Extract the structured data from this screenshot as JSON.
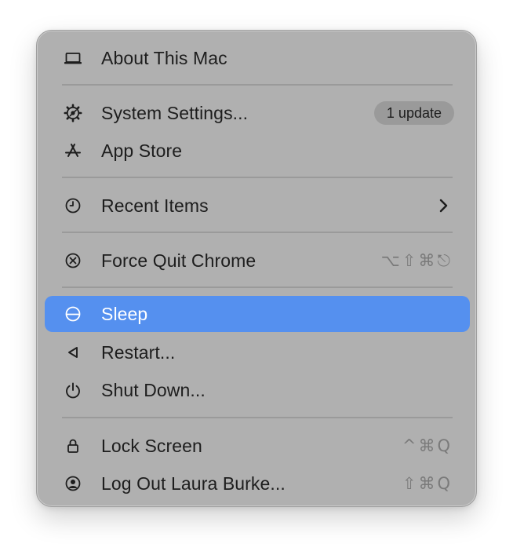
{
  "menu": {
    "about": {
      "label": "About This Mac",
      "icon": "laptop-icon"
    },
    "settings": {
      "label": "System Settings...",
      "icon": "gear-icon",
      "badge": "1 update"
    },
    "app_store": {
      "label": "App Store",
      "icon": "app-store-icon"
    },
    "recent_items": {
      "label": "Recent Items",
      "icon": "clock-icon",
      "submenu_icon": "chevron-right-icon"
    },
    "force_quit": {
      "label": "Force Quit Chrome",
      "icon": "force-quit-icon",
      "shortcut": "⌥⇧⌘⎋"
    },
    "sleep": {
      "label": "Sleep",
      "icon": "sleep-icon",
      "highlighted": true
    },
    "restart": {
      "label": "Restart...",
      "icon": "restart-icon"
    },
    "shut_down": {
      "label": "Shut Down...",
      "icon": "power-icon"
    },
    "lock_screen": {
      "label": "Lock Screen",
      "icon": "lock-icon",
      "shortcut": "^⌘Q"
    },
    "log_out": {
      "label": "Log Out Laura Burke...",
      "icon": "user-icon",
      "shortcut": "⇧⌘Q"
    }
  },
  "colors": {
    "menu_background": "#b0b0b0",
    "highlight": "#5590ef",
    "text": "#1d1d1d",
    "shortcut_text": "#7a7a7a",
    "separator": "#9a9a9a"
  }
}
